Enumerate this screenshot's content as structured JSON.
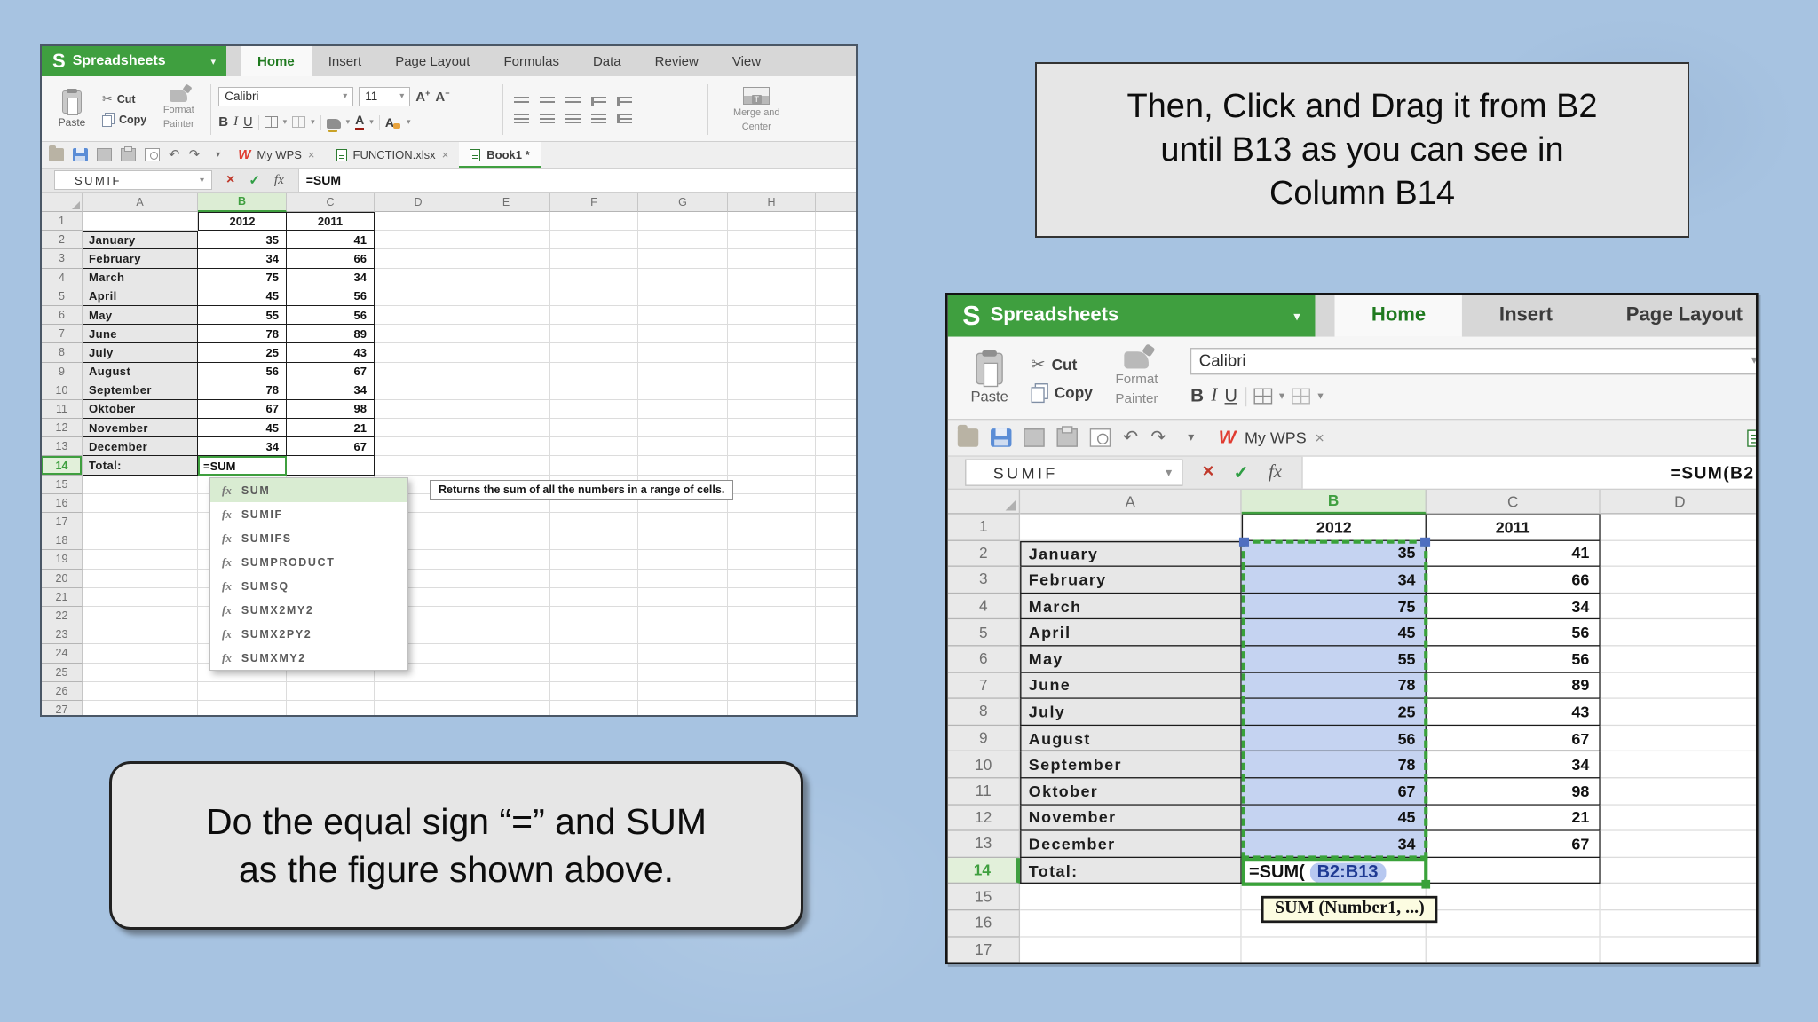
{
  "brand": {
    "letter": "S",
    "name": "Spreadsheets"
  },
  "shared": {
    "name_box": "SUMIF",
    "months": [
      "January",
      "February",
      "March",
      "April",
      "May",
      "June",
      "July",
      "August",
      "September",
      "Oktober",
      "November",
      "December"
    ],
    "col_2012": [
      35,
      34,
      75,
      45,
      55,
      78,
      25,
      56,
      78,
      67,
      45,
      34
    ],
    "col_2011": [
      41,
      66,
      34,
      56,
      56,
      89,
      43,
      67,
      34,
      98,
      21,
      67
    ],
    "year_b": "2012",
    "year_c": "2011",
    "total_label": "Total:"
  },
  "ribbon": {
    "paste": "Paste",
    "cut": "Cut",
    "copy": "Copy",
    "format_painter_1": "Format",
    "format_painter_2": "Painter",
    "font_name": "Calibri",
    "font_size": "11",
    "font_size_partial": "1",
    "bold": "B",
    "italic": "I",
    "underline": "U",
    "a_plus": "A",
    "a_minus": "A",
    "merge_1": "Merge and",
    "merge_2": "Center"
  },
  "left_sheet": {
    "tabs": [
      "Home",
      "Insert",
      "Page Layout",
      "Formulas",
      "Data",
      "Review",
      "View"
    ],
    "active_tab": "Home",
    "doc_tabs": [
      "My WPS",
      "FUNCTION.xlsx",
      "Book1 *"
    ],
    "active_doc_tab": "Book1 *",
    "formula_bar": "=SUM",
    "columns": [
      "A",
      "B",
      "C",
      "D",
      "E",
      "F",
      "G",
      "H"
    ],
    "visible_rows": 27,
    "total_formula": "=SUM",
    "fn_list": [
      "SUM",
      "SUMIF",
      "SUMIFS",
      "SUMPRODUCT",
      "SUMSQ",
      "SUMX2MY2",
      "SUMX2PY2",
      "SUMXMY2"
    ],
    "fn_selected": "SUM",
    "fn_tooltip": "Returns the sum of all the numbers in a range of cells."
  },
  "right_sheet": {
    "tabs": [
      "Home",
      "Insert",
      "Page Layout"
    ],
    "active_tab": "Home",
    "doc_tabs": [
      "My WPS"
    ],
    "formula_bar": "=SUM(B2",
    "columns": [
      "A",
      "B",
      "C",
      "D"
    ],
    "visible_rows": 17,
    "formula_prefix": "=SUM(",
    "formula_range": "B2:B13",
    "tooltip_parts": [
      "SUM (",
      "Number1",
      ", ...)"
    ]
  },
  "callout_top": {
    "lines": [
      "Then, Click and Drag it from B2",
      "until B13 as you can see in",
      "Column B14"
    ]
  },
  "callout_bottom": {
    "lines": [
      "Do the equal sign “=” and SUM",
      "as the figure shown above."
    ]
  },
  "colors": {
    "background_blue": "#a7c3e1",
    "wps_green": "#3f9f3f",
    "active_tab_green": "#1f7a1f",
    "selection_fill_blue": "#c5d3f1",
    "marching_ants_green": "#3aa23a",
    "range_pill_blue": "#b7c8f0",
    "tooltip_yellow": "#fcfce1",
    "callout_gray": "#e6e6e6",
    "save_icon_blue": "#5b8dd6",
    "wps_logo_red": "#e03c31",
    "close_x_red": "#c0392b",
    "check_green": "#2f9e44"
  }
}
